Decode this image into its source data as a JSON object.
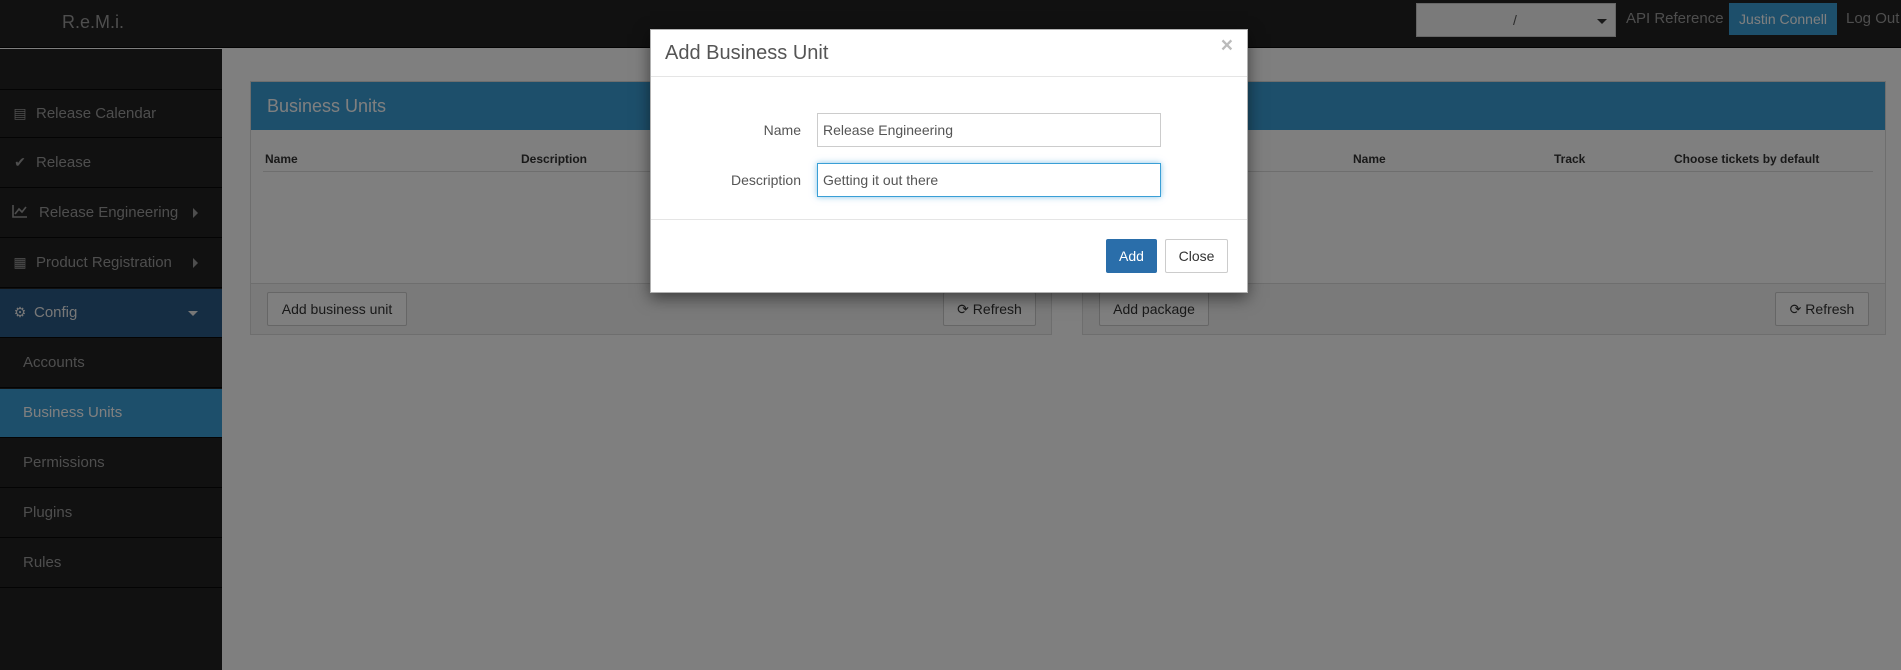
{
  "navbar": {
    "brand": "R.e.M.i.",
    "selector_value": "/",
    "api_reference": "API Reference",
    "user_name": "Justin Connell",
    "logout": "Log Out"
  },
  "sidebar": {
    "items": [
      {
        "label": "Release Calendar",
        "icon": "calendar-icon"
      },
      {
        "label": "Release",
        "icon": "check-icon"
      },
      {
        "label": "Release Engineering",
        "icon": "line-chart-icon"
      },
      {
        "label": "Product Registration",
        "icon": "puzzle-icon"
      },
      {
        "label": "Config",
        "icon": "gear-icon"
      }
    ],
    "sub_items": [
      "Accounts",
      "Business Units",
      "Permissions",
      "Plugins",
      "Rules"
    ]
  },
  "business_units_panel": {
    "title": "Business Units",
    "columns": [
      "Name",
      "Description"
    ],
    "add_button": "Add business unit",
    "refresh_button": "Refresh"
  },
  "packages_panel": {
    "columns": [
      "Name",
      "Track",
      "Choose tickets by default"
    ],
    "add_button": "Add package",
    "refresh_button": "Refresh"
  },
  "modal": {
    "title": "Add Business Unit",
    "close_symbol": "×",
    "name_label": "Name",
    "name_value": "Release Engineering",
    "description_label": "Description",
    "description_value": "Getting it out there",
    "add_button": "Add",
    "close_button": "Close"
  }
}
